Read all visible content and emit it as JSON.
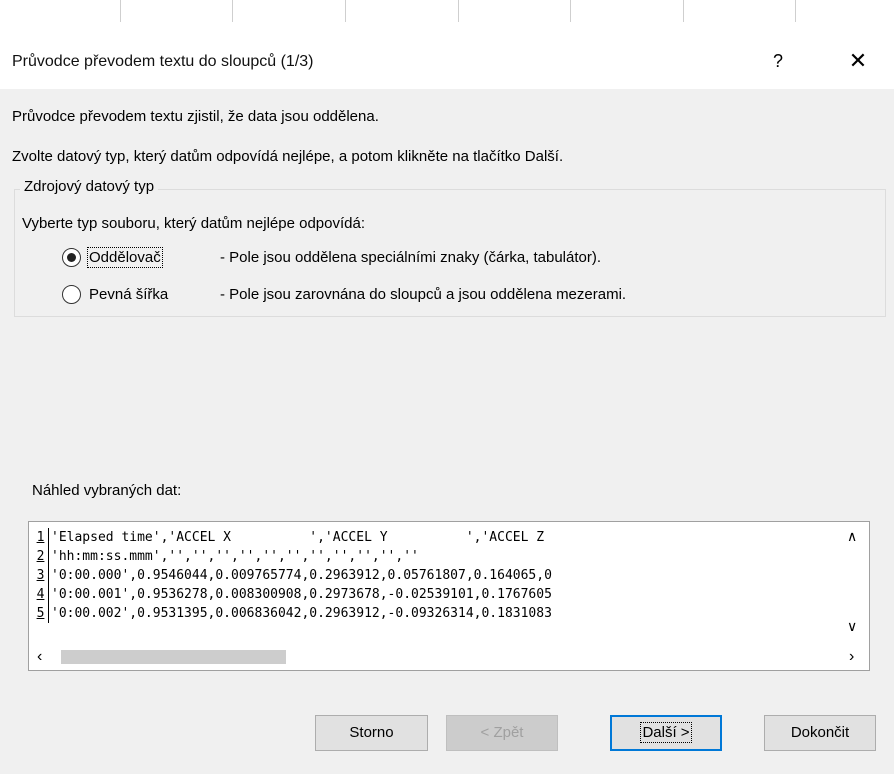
{
  "dialog": {
    "title": "Průvodce převodem textu do sloupců (1/3)",
    "help_label": "?",
    "close_label": "✕"
  },
  "intro": {
    "line1": "Průvodce převodem textu zjistil, že data jsou oddělena.",
    "line2": "Zvolte datový typ, který datům odpovídá nejlépe, a potom klikněte na tlačítko Další."
  },
  "source_type": {
    "legend": "Zdrojový datový typ",
    "prompt": "Vyberte typ souboru, který datům nejlépe odpovídá:",
    "options": [
      {
        "label": "Oddělovač",
        "description": "- Pole jsou oddělena speciálními znaky (čárka, tabulátor).",
        "selected": true
      },
      {
        "label": "Pevná šířka",
        "description": "- Pole jsou zarovnána do sloupců a jsou oddělena mezerami.",
        "selected": false
      }
    ]
  },
  "preview": {
    "label": "Náhled vybraných dat:",
    "rows": [
      {
        "num": "1",
        "text": "'Elapsed time','ACCEL X          ','ACCEL Y          ','ACCEL Z"
      },
      {
        "num": "2",
        "text": "'hh:mm:ss.mmm','','','','','','','','','','',''"
      },
      {
        "num": "3",
        "text": "'0:00.000',0.9546044,0.009765774,0.2963912,0.05761807,0.164065,0"
      },
      {
        "num": "4",
        "text": "'0:00.001',0.9536278,0.008300908,0.2973678,-0.02539101,0.1767605"
      },
      {
        "num": "5",
        "text": "'0:00.002',0.9531395,0.006836042,0.2963912,-0.09326314,0.1831083"
      }
    ]
  },
  "buttons": {
    "cancel": "Storno",
    "back": "< Zpět",
    "next": "Další >",
    "finish": "Dokončit"
  }
}
